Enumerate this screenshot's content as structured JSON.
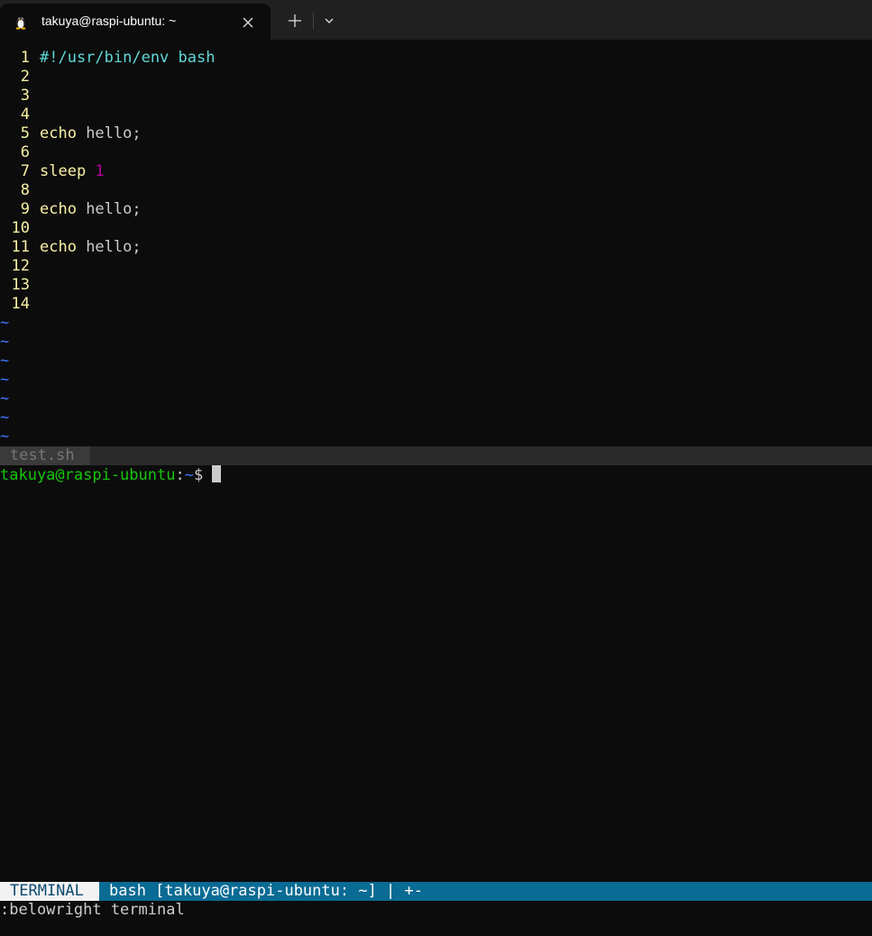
{
  "window": {
    "tab_title": "takuya@raspi-ubuntu: ~",
    "tab_icon": "linux-penguin-icon",
    "new_tab_icon": "plus-icon",
    "dropdown_icon": "chevron-down-icon",
    "close_icon": "close-icon"
  },
  "editor": {
    "lines": [
      {
        "num": "1",
        "tokens": [
          {
            "text": "#!/usr/bin/env bash",
            "kind": "shebang"
          }
        ]
      },
      {
        "num": "2",
        "tokens": []
      },
      {
        "num": "3",
        "tokens": []
      },
      {
        "num": "4",
        "tokens": []
      },
      {
        "num": "5",
        "tokens": [
          {
            "text": "echo",
            "kind": "kw"
          },
          {
            "text": " hello;",
            "kind": "plain"
          }
        ]
      },
      {
        "num": "6",
        "tokens": []
      },
      {
        "num": "7",
        "tokens": [
          {
            "text": "sleep",
            "kind": "kw"
          },
          {
            "text": " ",
            "kind": "plain"
          },
          {
            "text": "1",
            "kind": "num"
          }
        ]
      },
      {
        "num": "8",
        "tokens": []
      },
      {
        "num": "9",
        "tokens": [
          {
            "text": "echo",
            "kind": "kw"
          },
          {
            "text": " hello;",
            "kind": "plain"
          }
        ]
      },
      {
        "num": "10",
        "tokens": []
      },
      {
        "num": "11",
        "tokens": [
          {
            "text": "echo",
            "kind": "kw"
          },
          {
            "text": " hello;",
            "kind": "plain"
          }
        ]
      },
      {
        "num": "12",
        "tokens": []
      },
      {
        "num": "13",
        "tokens": []
      },
      {
        "num": "14",
        "tokens": []
      }
    ],
    "tilde_char": "~",
    "tilde_count": 7,
    "filename": "test.sh"
  },
  "terminal": {
    "prompt_user": "takuya@raspi-ubuntu",
    "prompt_sep": ":",
    "prompt_path": "~",
    "prompt_dollar": "$ ",
    "mode_label": "TERMINAL",
    "info_label": "bash [takuya@raspi-ubuntu: ~] | +-"
  },
  "cmdline": ":belowright terminal",
  "colors": {
    "background": "#0c0c0c",
    "line_number": "#f9f1a5",
    "shebang": "#61d6d6",
    "keyword": "#f9f1a5",
    "number": "#b4009e",
    "tilde": "#3b78ff",
    "prompt_user": "#16c60c",
    "prompt_path": "#3b78ff",
    "status_info_bg": "#0a6b94"
  }
}
